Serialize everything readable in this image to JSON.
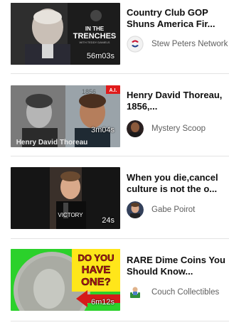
{
  "videos": [
    {
      "title": "Country Club GOP Shuns America Fir...",
      "duration": "56m03s",
      "channel": "Stew Peters Network",
      "thumb_text_1": "IN THE",
      "thumb_text_2": "TRENCHES",
      "thumb_text_3": "WITH TEDDY DANIELS",
      "avatar_icon": "stew-peters-network-logo-icon"
    },
    {
      "title": "Henry David Thoreau, 1856,...",
      "duration": "3m04s",
      "channel": "Mystery Scoop",
      "thumb_text_1": "1856",
      "thumb_text_2": "A.I.",
      "thumb_text_3": "Henry David Thoreau",
      "avatar_icon": "mystery-scoop-avatar-icon"
    },
    {
      "title": "When you die,cancel culture is not the o...",
      "duration": "24s",
      "channel": "Gabe Poirot",
      "thumb_text_1": "VICTORY",
      "avatar_icon": "gabe-poirot-avatar-icon"
    },
    {
      "title": "RARE Dime Coins You Should Know...",
      "duration": "6m12s",
      "channel": "Couch Collectibles",
      "thumb_text_1": "DO YOU",
      "thumb_text_2": "HAVE",
      "thumb_text_3": "ONE?",
      "avatar_icon": "couch-collectibles-avatar-icon"
    }
  ]
}
